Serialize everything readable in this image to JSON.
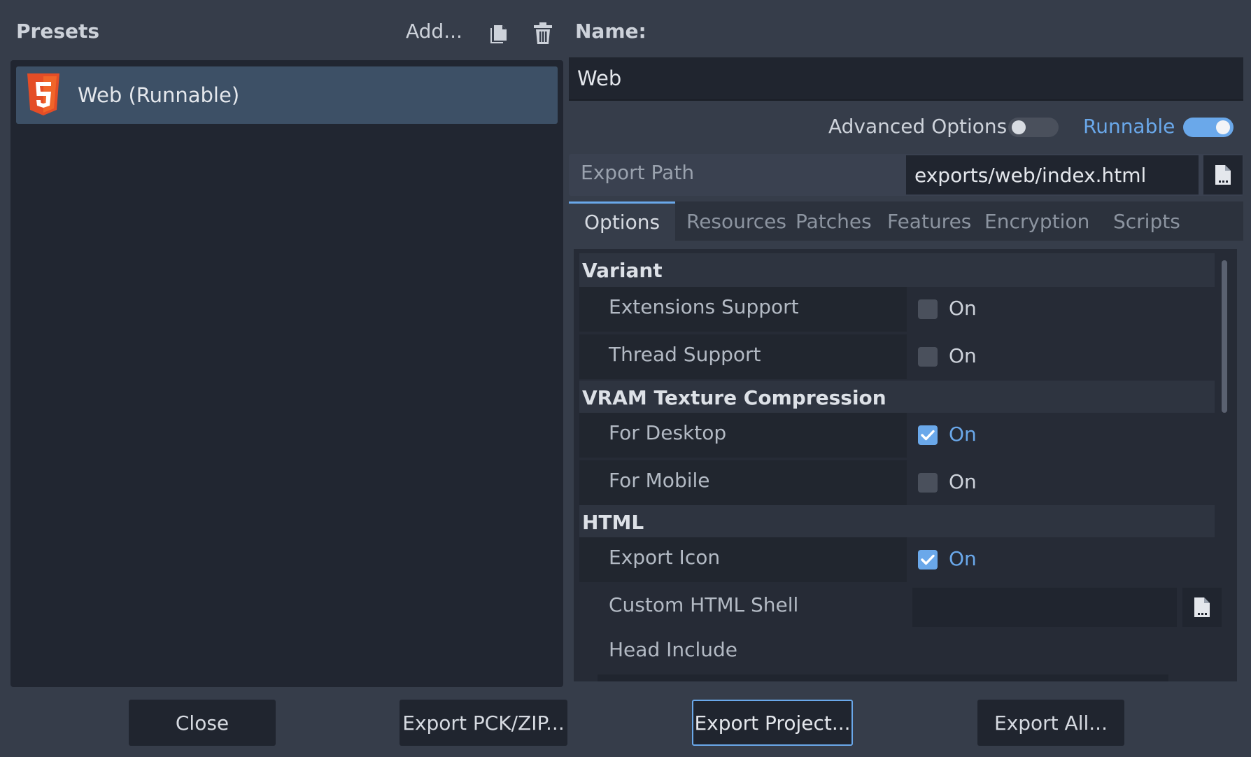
{
  "presets": {
    "title": "Presets",
    "add_label": "Add...",
    "duplicate_icon": "duplicate-icon",
    "delete_icon": "trash-icon",
    "items": [
      {
        "label": "Web (Runnable)",
        "icon": "html5-icon",
        "selected": true
      }
    ]
  },
  "preset": {
    "name_label": "Name:",
    "name_value": "Web",
    "advanced_options_label": "Advanced Options",
    "advanced_options_on": false,
    "runnable_label": "Runnable",
    "runnable_on": true,
    "export_path_label": "Export Path",
    "export_path_value": "exports/web/index.html"
  },
  "tabs": [
    "Options",
    "Resources",
    "Patches",
    "Features",
    "Encryption",
    "Scripts"
  ],
  "active_tab": "Options",
  "options": {
    "sections": [
      {
        "title": "Variant",
        "props": [
          {
            "label": "Extensions Support",
            "value": "On",
            "checked": false
          },
          {
            "label": "Thread Support",
            "value": "On",
            "checked": false
          }
        ]
      },
      {
        "title": "VRAM Texture Compression",
        "props": [
          {
            "label": "For Desktop",
            "value": "On",
            "checked": true
          },
          {
            "label": "For Mobile",
            "value": "On",
            "checked": false
          }
        ]
      },
      {
        "title": "HTML",
        "props": [
          {
            "label": "Export Icon",
            "value": "On",
            "checked": true
          },
          {
            "label": "Custom HTML Shell",
            "value": ""
          },
          {
            "label": "Head Include"
          }
        ]
      }
    ]
  },
  "buttons": {
    "close": "Close",
    "export_pck": "Export PCK/ZIP...",
    "export_project": "Export Project...",
    "export_all": "Export All..."
  },
  "colors": {
    "accent": "#6aa8ea",
    "background": "#363d4a",
    "panel": "#212631",
    "selected": "#3d5066",
    "html5_orange": "#e44d26"
  }
}
